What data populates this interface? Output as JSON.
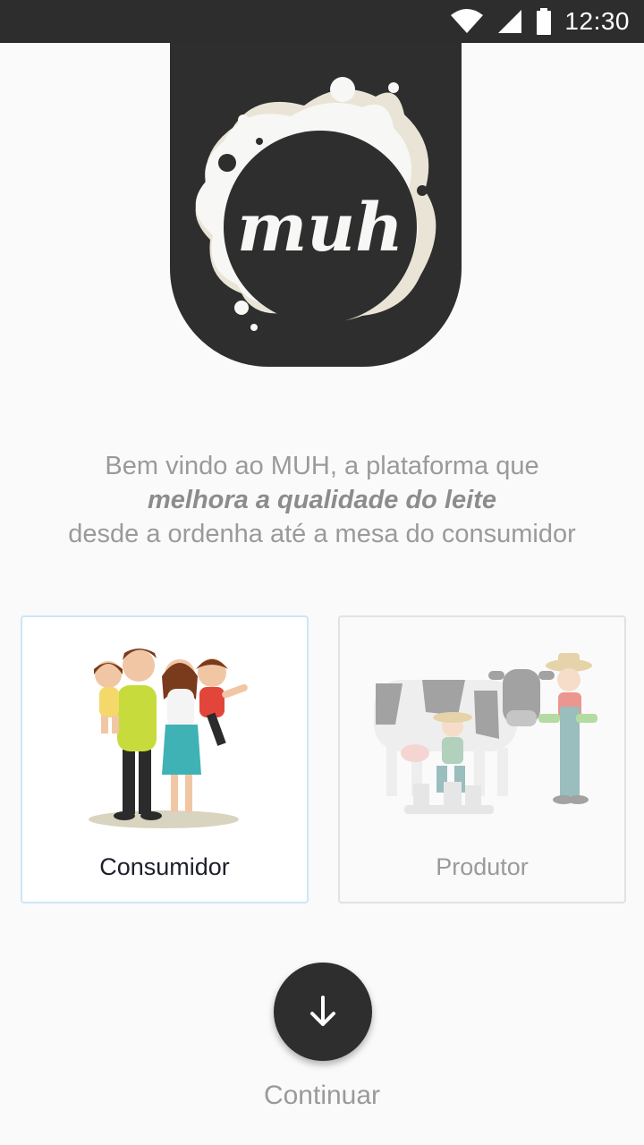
{
  "status_bar": {
    "time": "12:30",
    "icons": [
      "wifi-icon",
      "cell-signal-icon",
      "battery-icon"
    ]
  },
  "logo": {
    "text": "muh"
  },
  "welcome": {
    "line1": "Bem vindo ao MUH, a plataforma que",
    "line2": "melhora a qualidade do leite",
    "line3": "desde a ordenha até a mesa do consumidor"
  },
  "profiles": [
    {
      "label": "Consumidor",
      "selected": true,
      "illustration": "family-illustration"
    },
    {
      "label": "Produtor",
      "selected": false,
      "illustration": "farmers-cow-illustration"
    }
  ],
  "continue": {
    "label": "Continuar",
    "icon": "arrow-down-icon"
  },
  "colors": {
    "dark": "#2e2e2e",
    "background": "#fafafa",
    "muted_text": "#9a9a9a",
    "selected_border": "#cde6f6"
  }
}
